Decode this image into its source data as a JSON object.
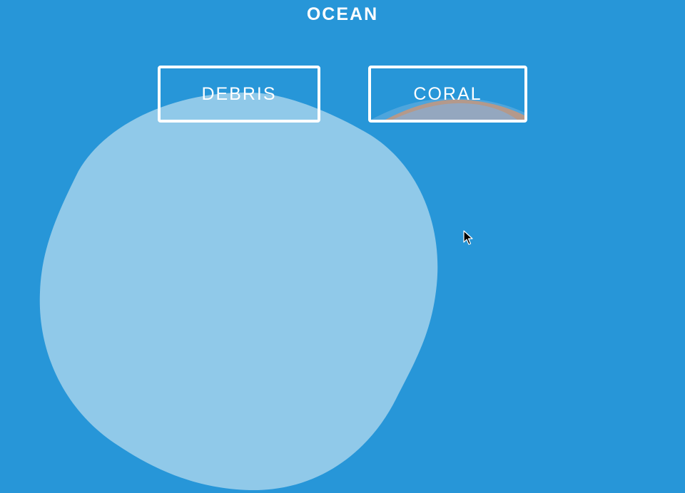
{
  "header": {
    "title": "OCEAN"
  },
  "buttons": {
    "debris_label": "DEBRIS",
    "coral_label": "CORAL"
  },
  "colors": {
    "background": "#2796d8",
    "blob": "#90c9e9",
    "button_border": "#ffffff",
    "coral_wave": "#c7967d"
  },
  "icons": {
    "cursor": "mouse-pointer-icon"
  }
}
